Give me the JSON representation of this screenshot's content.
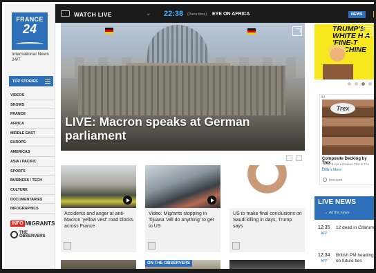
{
  "logo": {
    "line1": "FRANCE",
    "line2": "24"
  },
  "tagline": "International News 24/7",
  "top_stories_label": "TOP STORIES",
  "nav_items": [
    "VIDEOS",
    "SHOWS",
    "FRANCE",
    "AFRICA",
    "MIDDLE EAST",
    "EUROPE",
    "AMERICAS",
    "ASIA / PACIFIC",
    "SPORTS",
    "BUSINESS / TECH",
    "CULTURE",
    "DOCUMENTARIES",
    "INFOGRAPHICS"
  ],
  "infomigrants": {
    "part1": "INFO",
    "part2": "MIGRANTS"
  },
  "observers_logo": "THE OBSERVERS",
  "topbar": {
    "watch_live": "WATCH LIVE",
    "time": "22:38",
    "time_note": "(Paris time)",
    "program": "EYE ON AFRICA",
    "news_button": "NEWS"
  },
  "hero": {
    "title": "LIVE: Macron speaks at German parliament"
  },
  "cards": [
    {
      "text": "Accidents and anger at anti-Macron 'yellow vest' road blocks across France"
    },
    {
      "text": "Video: Migrants stopping in Tijuana 'will do anything' to get to US"
    },
    {
      "text": "US to make final conclusions on Saudi killing in days, Trump says"
    }
  ],
  "row2": {
    "observers_badge": "ON THE OBSERVERS"
  },
  "ad_top": {
    "text": "TRUMP'S WHITE H A 'FINE-T MACHINE"
  },
  "ad_side": {
    "label": "Ad",
    "brand": "Trex",
    "headline": "Composite Decking by Trex",
    "body": "These 5 Are a Reason This Is The New",
    "link": "Learn More",
    "url": "trex.com"
  },
  "live_news": {
    "title": "LIVE NEWS",
    "all_link": "All the news",
    "items": [
      {
        "time": "12:35",
        "source": "AFP",
        "text": "12 dead in Citarum"
      },
      {
        "time": "12:34",
        "source": "AFP",
        "text": "British PM heading on future ties"
      }
    ]
  },
  "colors": {
    "brand_blue": "#2d6fb9",
    "accent_orange": "#f5a623",
    "time_blue": "#3fb3ff"
  }
}
